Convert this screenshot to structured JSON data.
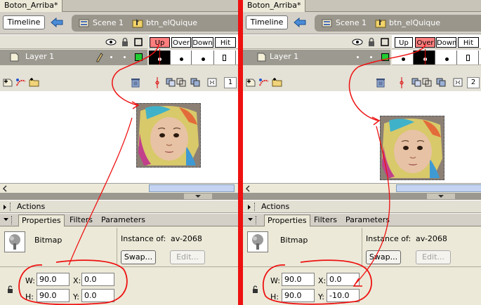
{
  "document_tab": "Boton_Arriba*",
  "edit_bar": {
    "timeline_label": "Timeline",
    "scene_label": "Scene 1",
    "symbol_label": "btn_elQuique"
  },
  "timeline": {
    "layer_name": "Layer 1",
    "frame_labels": [
      "Up",
      "Over",
      "Down",
      "Hit"
    ]
  },
  "panels": {
    "actions_title": "Actions",
    "tabs": [
      "Properties",
      "Filters",
      "Parameters"
    ]
  },
  "properties": {
    "type_label": "Bitmap",
    "instance_of_label": "Instance of:",
    "instance_name": "av-2068",
    "swap_label": "Swap...",
    "edit_label": "Edit...",
    "w_label": "W:",
    "h_label": "H:",
    "x_label": "X:",
    "y_label": "Y:"
  },
  "panes": [
    {
      "current_frame_label": "Up",
      "current_frame_number": "1",
      "width": "90.0",
      "height": "90.0",
      "x": "0.0",
      "y": "0.0"
    },
    {
      "current_frame_label": "Over",
      "current_frame_number": "2",
      "width": "90.0",
      "height": "90.0",
      "x": "0.0",
      "y": "-10.0"
    }
  ],
  "colors": {
    "divider": "#ee1111",
    "annotation": "#ee1111",
    "current_frame": "#ff7e7e"
  }
}
